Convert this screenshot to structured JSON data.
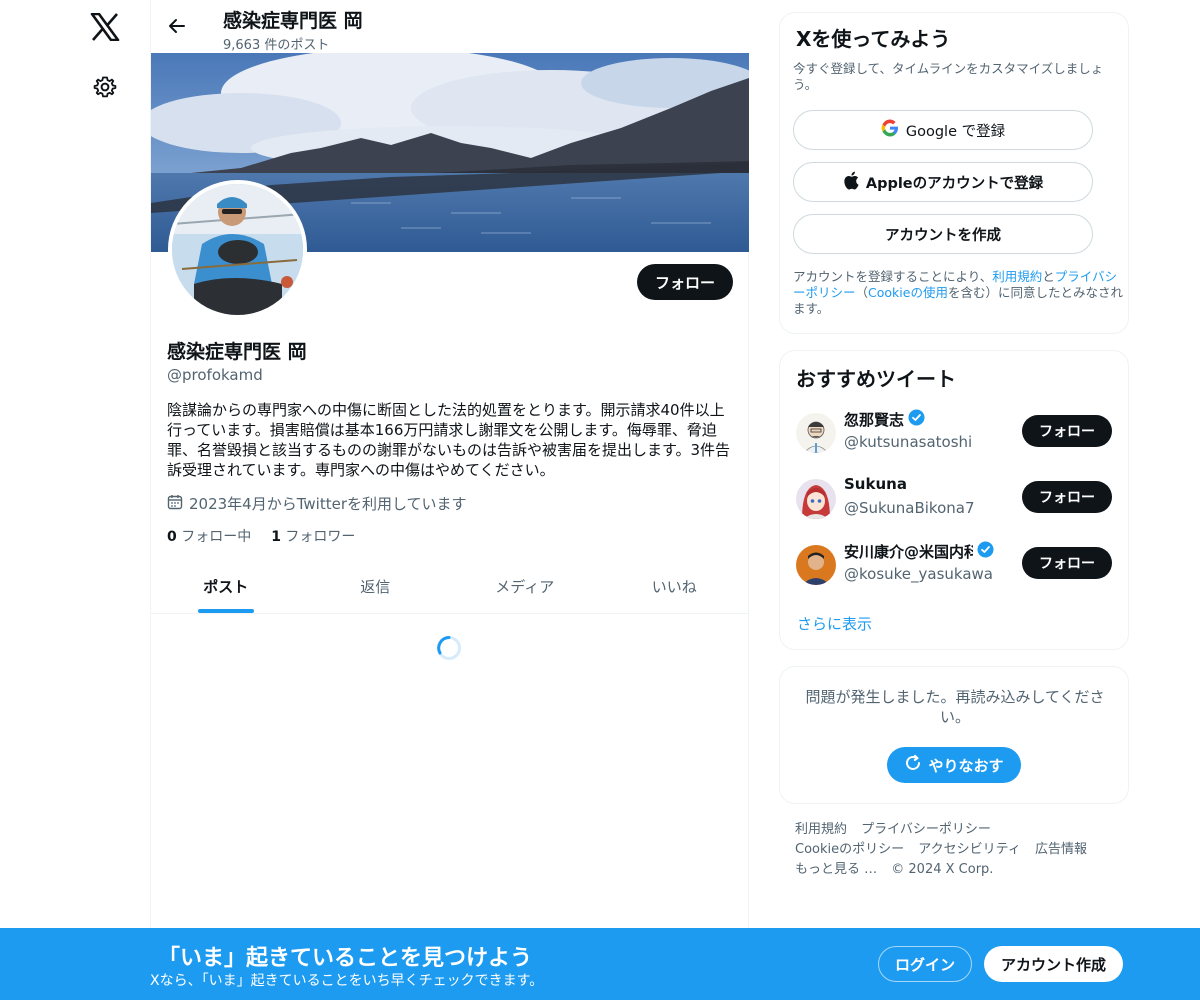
{
  "colors": {
    "accent": "#1d9bf0",
    "text": "#0f1419",
    "muted": "#536471",
    "border": "#eff3f4"
  },
  "nav": {
    "logo_icon": "x-logo-icon",
    "settings_icon": "gear-icon"
  },
  "header": {
    "title": "感染症専門医 岡",
    "post_count": "9,663 件のポスト",
    "back_icon": "arrow-left-icon"
  },
  "profile": {
    "name": "感染症専門医 岡",
    "handle": "@profokamd",
    "follow_label": "フォロー",
    "bio": "陰謀論からの専門家への中傷に断固とした法的処置をとります。開示請求40件以上行っています。損害賠償は基本166万円請求し謝罪文を公開します。侮辱罪、脅迫罪、名誉毀損と該当するものの謝罪がないものは告訴や被害届を提出します。3件告訴受理されています。専門家への中傷はやめてください。",
    "joined": "2023年4月からTwitterを利用しています",
    "following_count": "0",
    "following_label": "フォロー中",
    "followers_count": "1",
    "followers_label": "フォロワー"
  },
  "tabs": [
    {
      "label": "ポスト",
      "active": true
    },
    {
      "label": "返信",
      "active": false
    },
    {
      "label": "メディア",
      "active": false
    },
    {
      "label": "いいね",
      "active": false
    }
  ],
  "signup_card": {
    "title": "Xを使ってみよう",
    "description": "今すぐ登録して、タイムラインをカスタマイズしましょう。",
    "google_label": "Google で登録",
    "apple_label": "Appleのアカウントで登録",
    "create_label": "アカウントを作成",
    "terms_prefix": "アカウントを登録することにより、",
    "terms_link": "利用規約",
    "terms_and": "と",
    "privacy_link": "プライバシーポリシー",
    "cookie_open": "（",
    "cookie_link": "Cookieの使用",
    "cookie_suffix": "を含む）に同意したとみなされます。"
  },
  "recommend_card": {
    "title": "おすすめツイート",
    "users": [
      {
        "name": "忽那賢志",
        "handle": "@kutsunasatoshi",
        "verified": true,
        "follow_label": "フォロー"
      },
      {
        "name": "Sukuna",
        "handle": "@SukunaBikona7",
        "verified": false,
        "follow_label": "フォロー"
      },
      {
        "name": "安川康介@米国内科専",
        "handle": "@kosuke_yasukawa",
        "verified": true,
        "follow_label": "フォロー"
      }
    ],
    "more_label": "さらに表示"
  },
  "error_card": {
    "message": "問題が発生しました。再読み込みしてください。",
    "retry_label": "やりなおす"
  },
  "footer": {
    "links": [
      "利用規約",
      "プライバシーポリシー",
      "Cookieのポリシー",
      "アクセシビリティ",
      "広告情報",
      "もっと見る …"
    ],
    "copyright": "© 2024 X Corp."
  },
  "bottom_bar": {
    "title": "「いま」起きていることを見つけよう",
    "subtitle": "Xなら、「いま」起きていることをいち早くチェックできます。",
    "login_label": "ログイン",
    "signup_label": "アカウント作成"
  }
}
